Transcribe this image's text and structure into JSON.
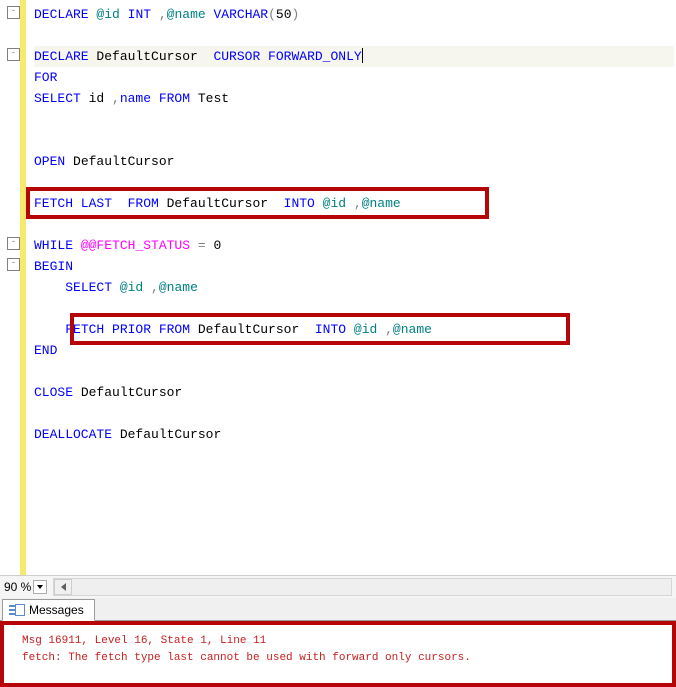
{
  "code": {
    "lines": [
      {
        "type": "code",
        "indent": 0,
        "parts": [
          {
            "class": "kw-blue",
            "t": "DECLARE "
          },
          {
            "class": "kw-teal",
            "t": "@id "
          },
          {
            "class": "kw-blue",
            "t": "INT "
          },
          {
            "class": "kw-gray",
            "t": ","
          },
          {
            "class": "kw-teal",
            "t": "@name "
          },
          {
            "class": "kw-blue",
            "t": "VARCHAR"
          },
          {
            "class": "kw-gray",
            "t": "("
          },
          {
            "class": "plain",
            "t": "50"
          },
          {
            "class": "kw-gray",
            "t": ")"
          }
        ],
        "fold": "-",
        "foldTop": 4,
        "highlit": false
      },
      {
        "type": "blank"
      },
      {
        "type": "code",
        "indent": 0,
        "fold": "-",
        "foldTop": 46,
        "highlit": true,
        "parts": [
          {
            "class": "kw-blue",
            "t": "DECLARE "
          },
          {
            "class": "plain",
            "t": "DefaultCursor  "
          },
          {
            "class": "kw-blue",
            "t": "CURSOR FORWARD_ONLY"
          }
        ],
        "cursor": true
      },
      {
        "type": "code",
        "indent": 0,
        "parts": [
          {
            "class": "kw-blue",
            "t": "FOR"
          }
        ]
      },
      {
        "type": "code",
        "indent": 0,
        "parts": [
          {
            "class": "kw-blue",
            "t": "SELECT "
          },
          {
            "class": "plain",
            "t": "id "
          },
          {
            "class": "kw-gray",
            "t": ","
          },
          {
            "class": "kw-blue",
            "t": "name FROM "
          },
          {
            "class": "plain",
            "t": "Test"
          }
        ]
      },
      {
        "type": "blank"
      },
      {
        "type": "blank"
      },
      {
        "type": "code",
        "indent": 0,
        "parts": [
          {
            "class": "kw-blue",
            "t": "OPEN "
          },
          {
            "class": "plain",
            "t": "DefaultCursor"
          }
        ]
      },
      {
        "type": "blank"
      },
      {
        "type": "code",
        "indent": 0,
        "parts": [
          {
            "class": "kw-blue",
            "t": "FETCH LAST  FROM "
          },
          {
            "class": "plain",
            "t": "DefaultCursor  "
          },
          {
            "class": "kw-blue",
            "t": "INTO "
          },
          {
            "class": "kw-teal",
            "t": "@id "
          },
          {
            "class": "kw-gray",
            "t": ","
          },
          {
            "class": "kw-teal",
            "t": "@name"
          }
        ]
      },
      {
        "type": "blank"
      },
      {
        "type": "code",
        "indent": 0,
        "fold": "-",
        "foldTop": 235,
        "parts": [
          {
            "class": "kw-blue",
            "t": "WHILE "
          },
          {
            "class": "kw-pink",
            "t": "@@FETCH_STATUS "
          },
          {
            "class": "kw-gray",
            "t": "= "
          },
          {
            "class": "plain",
            "t": "0"
          }
        ]
      },
      {
        "type": "code",
        "indent": 0,
        "fold": "-",
        "foldTop": 256,
        "parts": [
          {
            "class": "kw-blue",
            "t": "BEGIN"
          }
        ]
      },
      {
        "type": "code",
        "indent": 1,
        "parts": [
          {
            "class": "kw-blue",
            "t": "SELECT "
          },
          {
            "class": "kw-teal",
            "t": "@id "
          },
          {
            "class": "kw-gray",
            "t": ","
          },
          {
            "class": "kw-teal",
            "t": "@name"
          }
        ]
      },
      {
        "type": "blank"
      },
      {
        "type": "code",
        "indent": 1,
        "parts": [
          {
            "class": "kw-blue",
            "t": "FETCH PRIOR FROM "
          },
          {
            "class": "plain",
            "t": "DefaultCursor  "
          },
          {
            "class": "kw-blue",
            "t": "INTO "
          },
          {
            "class": "kw-teal",
            "t": "@id "
          },
          {
            "class": "kw-gray",
            "t": ","
          },
          {
            "class": "kw-teal",
            "t": "@name"
          }
        ]
      },
      {
        "type": "code",
        "indent": 0,
        "parts": [
          {
            "class": "kw-blue",
            "t": "END"
          }
        ]
      },
      {
        "type": "blank"
      },
      {
        "type": "code",
        "indent": 0,
        "parts": [
          {
            "class": "kw-blue",
            "t": "CLOSE "
          },
          {
            "class": "plain",
            "t": "DefaultCursor"
          }
        ]
      },
      {
        "type": "blank"
      },
      {
        "type": "code",
        "indent": 0,
        "parts": [
          {
            "class": "kw-blue",
            "t": "DEALLOCATE "
          },
          {
            "class": "plain",
            "t": "DefaultCursor"
          }
        ]
      },
      {
        "type": "blank"
      },
      {
        "type": "blank"
      }
    ]
  },
  "zoom": {
    "level": "90 %"
  },
  "results": {
    "tab_label": "Messages"
  },
  "messages": {
    "line1": "Msg 16911, Level 16, State 1, Line 11",
    "line2": "fetch: The fetch type last cannot be used with forward only cursors."
  }
}
